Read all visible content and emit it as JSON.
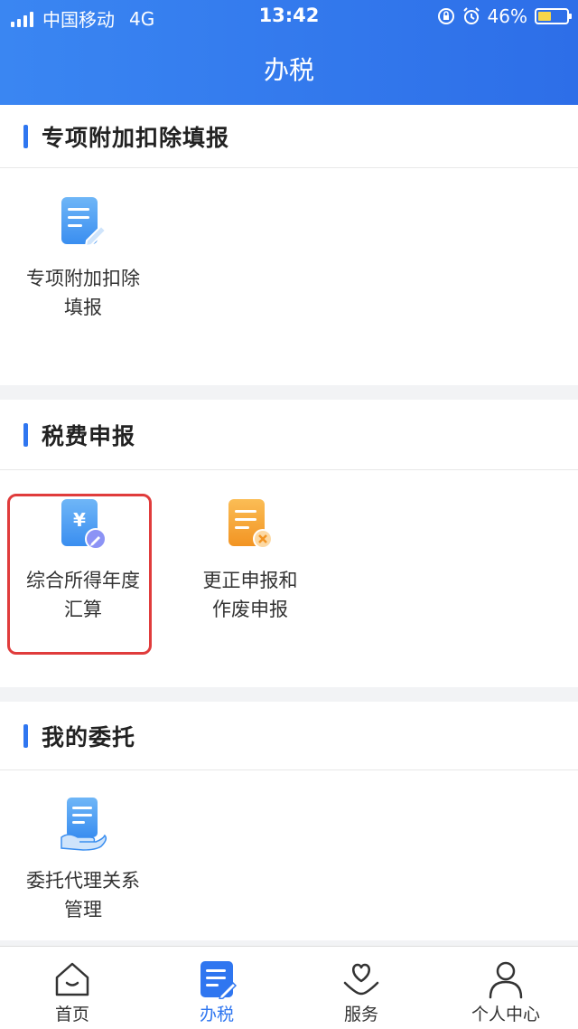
{
  "status_bar": {
    "carrier": "中国移动",
    "network": "4G",
    "time": "13:42",
    "battery": "46%",
    "battery_level": 0.46
  },
  "header": {
    "title": "办税"
  },
  "sections": [
    {
      "title": "专项附加扣除填报",
      "items": [
        {
          "label_line1": "专项附加扣除",
          "label_line2": "填报",
          "icon": "document-edit-icon"
        }
      ]
    },
    {
      "title": "税费申报",
      "items": [
        {
          "label_line1": "综合所得年度",
          "label_line2": "汇算",
          "icon": "yuan-document-icon"
        },
        {
          "label_line1": "更正申报和",
          "label_line2": "作废申报",
          "icon": "document-cancel-icon"
        }
      ]
    },
    {
      "title": "我的委托",
      "items": [
        {
          "label_line1": "委托代理关系",
          "label_line2": "管理",
          "icon": "document-hand-icon"
        }
      ]
    }
  ],
  "tabbar": {
    "tabs": [
      {
        "label": "首页",
        "icon": "home-icon"
      },
      {
        "label": "办税",
        "icon": "tax-document-icon"
      },
      {
        "label": "服务",
        "icon": "heart-hand-icon"
      },
      {
        "label": "个人中心",
        "icon": "person-icon"
      }
    ],
    "active": "办税"
  },
  "colors": {
    "primary": "#2f76f0",
    "highlight": "#e03c3c",
    "orange": "#f59a2a"
  }
}
